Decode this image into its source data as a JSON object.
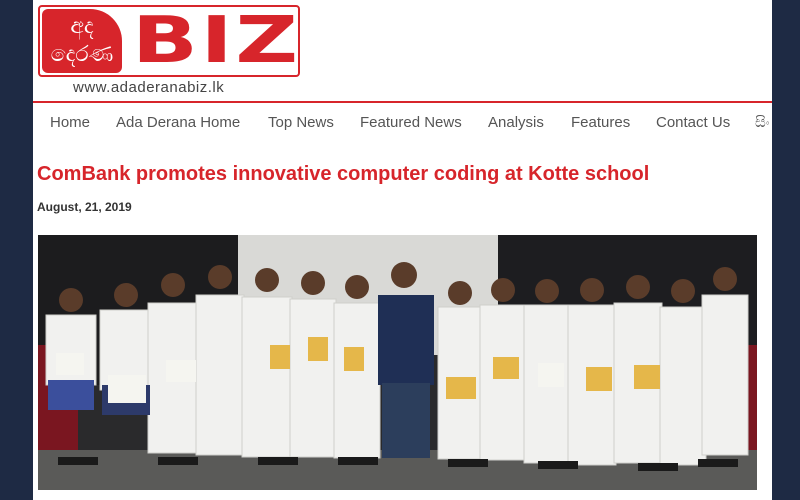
{
  "brand": {
    "logo_script": "අද දෙරණ",
    "logo_text": "BIZ",
    "url": "www.adaderanabiz.lk",
    "accent_color": "#d7252b"
  },
  "nav": {
    "items": [
      {
        "label": "Home"
      },
      {
        "label": "Ada Derana Home"
      },
      {
        "label": "Top News"
      },
      {
        "label": "Featured News"
      },
      {
        "label": "Analysis"
      },
      {
        "label": "Features"
      },
      {
        "label": "Contact Us"
      },
      {
        "label": "සිං"
      }
    ]
  },
  "article": {
    "title": "ComBank promotes innovative computer coding at Kotte school",
    "date": "August, 21, 2019",
    "photo_icon": "group-photo"
  }
}
